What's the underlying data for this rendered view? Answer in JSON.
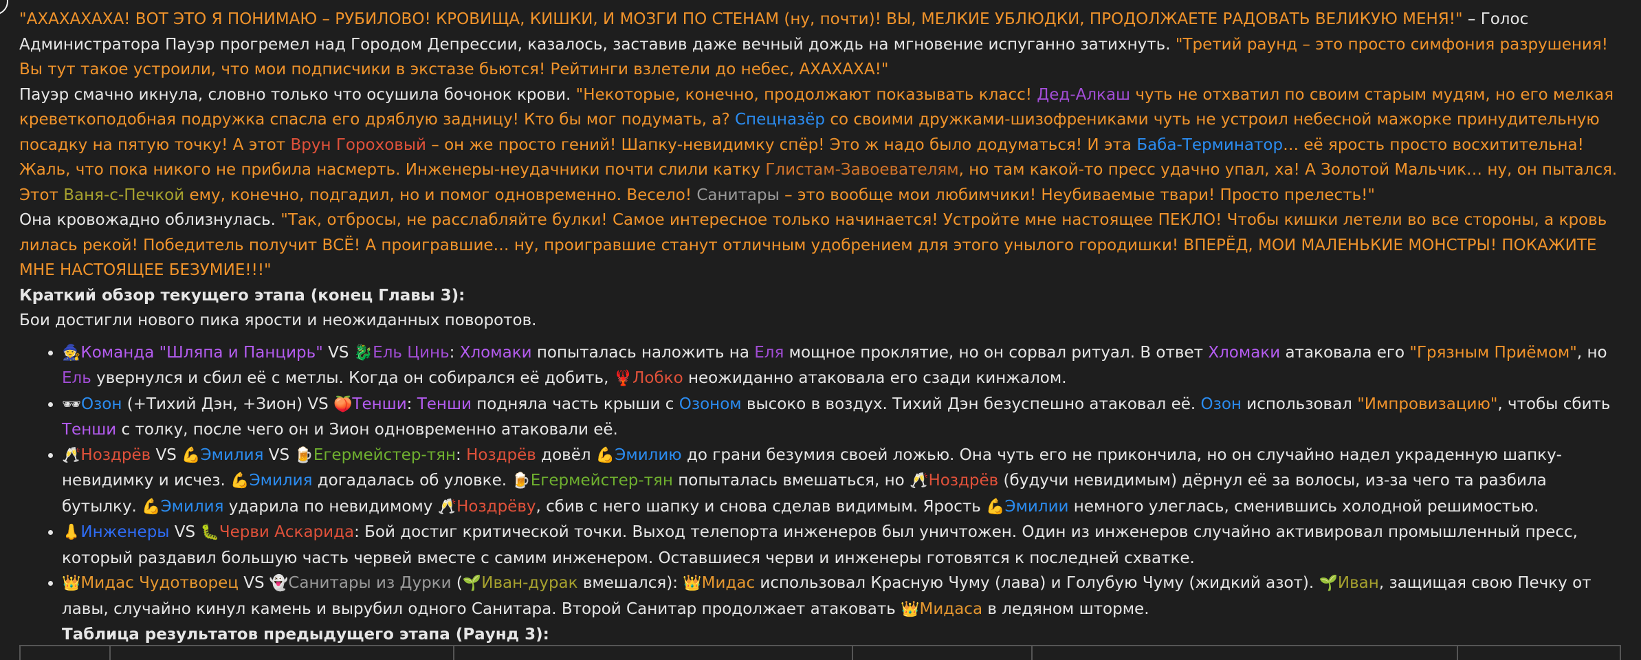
{
  "intro": {
    "p1_quote": "\"АХАХАХАХА! ВОТ ЭТО Я ПОНИМАЮ – РУБИЛОВО! КРОВИЩА, КИШКИ, И МОЗГИ ПО СТЕНАМ (ну, почти)! ВЫ, МЕЛКИЕ УБЛЮДКИ, ПРОДОЛЖАЕТЕ РАДОВАТЬ ВЕЛИКУЮ МЕНЯ!\"",
    "p1_narr": " – Голос Администратора Пауэр прогремел над Городом Депрессии, казалось, заставив даже вечный дождь на мгновение испуганно затихнуть. ",
    "p1_quote2": "\"Третий раунд – это просто симфония разрушения! Вы тут такое устроили, что мои подписчики в экстазе бьются! Рейтинги взлетели до небес, АХАХАХА!\"",
    "p2_narr": "Пауэр смачно икнула, словно только что осушила бочонок крови. ",
    "p2_q1": "\"Некоторые, конечно, продолжают показывать класс! ",
    "p2_ded": "Дед-Алкаш",
    "p2_q2": " чуть не отхватил по своим старым мудям, но его мелкая креветкоподобная подружка спасла его дряблую задницу! Кто бы мог подумать, а? ",
    "p2_spec": "Спецназёр",
    "p2_q3": " со своими дружками-шизофрениками чуть не устроил небесной мажорке принудительную посадку на пятую точку! А этот ",
    "p2_vrun": "Врун Гороховый",
    "p2_q4": " – он же просто гений! Шапку-невидимку спёр! Это ж надо было додуматься! И эта ",
    "p2_baba": "Баба-Терминатор",
    "p2_q5": "… её ярость просто восхитительна! Жаль, что пока никого не прибила насмерть. Инженеры-неудачники почти слили катку ",
    "p2_glist": "Глистам-Завоевателям",
    "p2_q6": ", но там какой-то пресс удачно упал, ха! А Золотой Мальчик… ну, он пытался. Этот ",
    "p2_vanya": "Ваня-с-Печкой",
    "p2_q7": " ему, конечно, подгадил, но и помог одновременно. Весело! ",
    "p2_san": "Санитары",
    "p2_q8": " – это вообще мои любимчики! Неубиваемые твари! Просто прелесть!\"",
    "p3_narr": "Она кровожадно облизнулась. ",
    "p3_quote": "\"Так, отбросы, не расслабляйте булки! Самое интересное только начинается! Устройте мне настоящее ПЕКЛО! Чтобы кишки летели во все стороны, а кровь лилась рекой! Победитель получит ВСЁ! А проигравшие… ну, проигравшие станут отличным удобрением для этого унылого городишки! ВПЕРЁД, МОИ МАЛЕНЬКИЕ МОНСТРЫ! ПОКАЖИТЕ МНЕ НАСТОЯЩЕЕ БЕЗУМИЕ!!!\""
  },
  "summary": {
    "heading": "Краткий обзор текущего этапа (конец Главы 3):",
    "text": "Бои достигли нового пика ярости и неожиданных поворотов."
  },
  "items": {
    "i1": {
      "emo1": "🧙",
      "team": "Команда \"Шляпа и Панцирь\"",
      "vs": " VS ",
      "emo2": "🐉",
      "opp": "Ель Цинь",
      "colon": ": ",
      "hlom": "Хломаки",
      "t1": " попыталась наложить на ",
      "el1": "Еля",
      "t2": " мощное проклятие, но он сорвал ритуал. В ответ ",
      "hlom2": "Хломаки",
      "t3": " атаковала его ",
      "dirty": "\"Грязным Приёмом\"",
      "t4": ", но ",
      "el2": "Ель",
      "t5": " увернулся и сбил её с метлы. Когда он собирался её добить, ",
      "emo3": "🦞",
      "lobko": "Лобко",
      "t6": " неожиданно атаковала его сзади кинжалом."
    },
    "i2": {
      "emo1": "🕶",
      "ozon": "Озон",
      "t1": " (+Тихий Дэн, +Зион) VS ",
      "emo2": "🍑",
      "tenshi": "Тенши",
      "colon": ": ",
      "tenshi2": "Тенши",
      "t2": " подняла часть крыши с ",
      "ozonom": "Озоном",
      "t3": " высоко в воздух. Тихий Дэн безуспешно атаковал её. ",
      "ozon2": "Озон",
      "t4": " использовал ",
      "improv": "\"Импровизацию\"",
      "t5": ", чтобы сбить ",
      "tenshi3": "Тенши",
      "t6": " с толку, после чего он и Зион одновременно атаковали её."
    },
    "i3": {
      "emo_n": "🥂",
      "nozdrev": "Ноздрёв",
      "vs1": " VS ",
      "emo_e": "💪",
      "emilia": "Эмилия",
      "vs2": " VS ",
      "emo_b": "🍺",
      "eger": "Егермейстер-тян",
      "colon": ": ",
      "nozdrev2": "Ноздрёв",
      "t1": " довёл ",
      "emiliu": "Эмилию",
      "t2": " до грани безумия своей ложью. Она чуть его не прикончила, но он случайно надел украденную шапку-невидимку и исчез. ",
      "emilia2": "Эмилия",
      "t3": " догадалась об уловке. ",
      "eger2": "Егермейстер-тян",
      "t4": " попыталась вмешаться, но ",
      "nozdrev3": "Ноздрёв",
      "t5": " (будучи невидимым) дёрнул её за волосы, из-за чего та разбила бутылку. ",
      "emilia3": "Эмилия",
      "t6": " ударила по невидимому ",
      "nozdrevu": "Ноздрёву",
      "t7": ", сбив с него шапку и снова сделав видимым. Ярость ",
      "emilii": "Эмилии",
      "t8": " немного улеглась, сменившись холодной решимостью."
    },
    "i4": {
      "emo1": "👃",
      "eng": "Инженеры",
      "vs": " VS ",
      "emo2": "🐛",
      "worms": "Черви Аскарида",
      "t1": ": Бой достиг критической точки. Выход телепорта инженеров был уничтожен. Один из инженеров случайно активировал промышленный пресс, который раздавил большую часть червей вместе с самим инженером. Оставшиеся черви и инженеры готовятся к последней схватке."
    },
    "i5": {
      "emo1": "👑",
      "midas": "Мидас Чудотворец",
      "vs": " VS ",
      "emo2": "👻",
      "san": "Санитары из Дурки",
      "t0": " (",
      "emo3": "🌱",
      "ivan": "Иван-дурак",
      "t1": " вмешался): ",
      "emo4": "👑",
      "midas2": "Мидас",
      "t2": " использовал Красную Чуму (лава) и Голубую Чуму (жидкий азот). ",
      "emo5": "🌱",
      "ivan2": "Иван",
      "t3": ", защищая свою Печку от лавы, случайно кинул камень и вырубил одного Санитара. Второй Санитар продолжает атаковать ",
      "emo6": "👑",
      "midasa": "Мидаса",
      "t4": " в ледяном шторме."
    },
    "table_heading": "Таблица результатов предыдущего этапа (Раунд 3):"
  }
}
